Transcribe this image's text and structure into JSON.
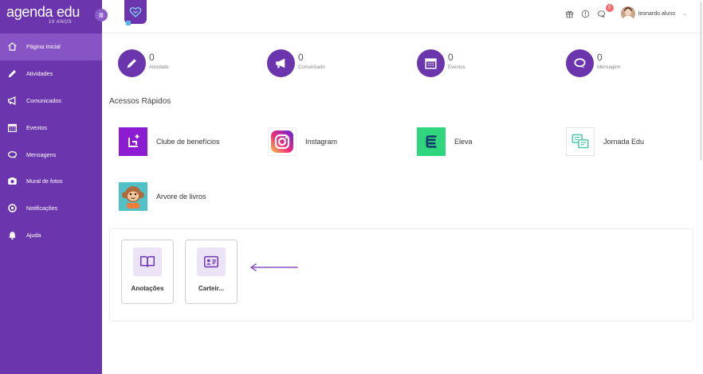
{
  "brand": {
    "name_bold": "agenda",
    "name_light": " edu",
    "subtitle": "10 ANOS"
  },
  "sidebar": {
    "items": [
      {
        "label": "Página Inicial",
        "icon": "home-icon",
        "active": true
      },
      {
        "label": "Atividades",
        "icon": "pencil-icon"
      },
      {
        "label": "Comunicados",
        "icon": "megaphone-icon"
      },
      {
        "label": "Eventos",
        "icon": "calendar-icon"
      },
      {
        "label": "Mensagens",
        "icon": "chat-icon"
      },
      {
        "label": "Mural de fotos",
        "icon": "camera-icon"
      },
      {
        "label": "Notificações",
        "icon": "notification-icon"
      },
      {
        "label": "Ajuda",
        "icon": "bell-icon"
      }
    ]
  },
  "topbar": {
    "icons": [
      "gift-icon",
      "info-icon",
      "chat-icon"
    ],
    "notification_count": "0",
    "user_name": "leonardo aluno",
    "caret": "⌄"
  },
  "stats": [
    {
      "count": "0",
      "label": "Atividade",
      "icon": "pencil-icon"
    },
    {
      "count": "0",
      "label": "Comunicado",
      "icon": "megaphone-icon"
    },
    {
      "count": "0",
      "label": "Eventos",
      "icon": "calendar-icon"
    },
    {
      "count": "0",
      "label": "Mensagem",
      "icon": "chat-icon"
    }
  ],
  "quick_access": {
    "title": "Acessos Rápidos",
    "items": [
      {
        "label": "Clube de benefícios",
        "icon": "benefits-club-icon"
      },
      {
        "label": "Instagram",
        "icon": "instagram-icon"
      },
      {
        "label": "Eleva",
        "icon": "eleva-icon"
      },
      {
        "label": "Jornada Edu",
        "icon": "jornada-edu-icon"
      },
      {
        "label": "Arvore de livros",
        "icon": "arvore-monkey-icon"
      }
    ]
  },
  "tiles": [
    {
      "label": "Anotações",
      "icon": "open-book-icon"
    },
    {
      "label": "Carteir...",
      "icon": "id-card-icon"
    }
  ],
  "colors": {
    "primary": "#6b35ad",
    "primary_active": "#8654c4",
    "tile_bg": "#ece4f6",
    "badge": "#f06b6b"
  }
}
